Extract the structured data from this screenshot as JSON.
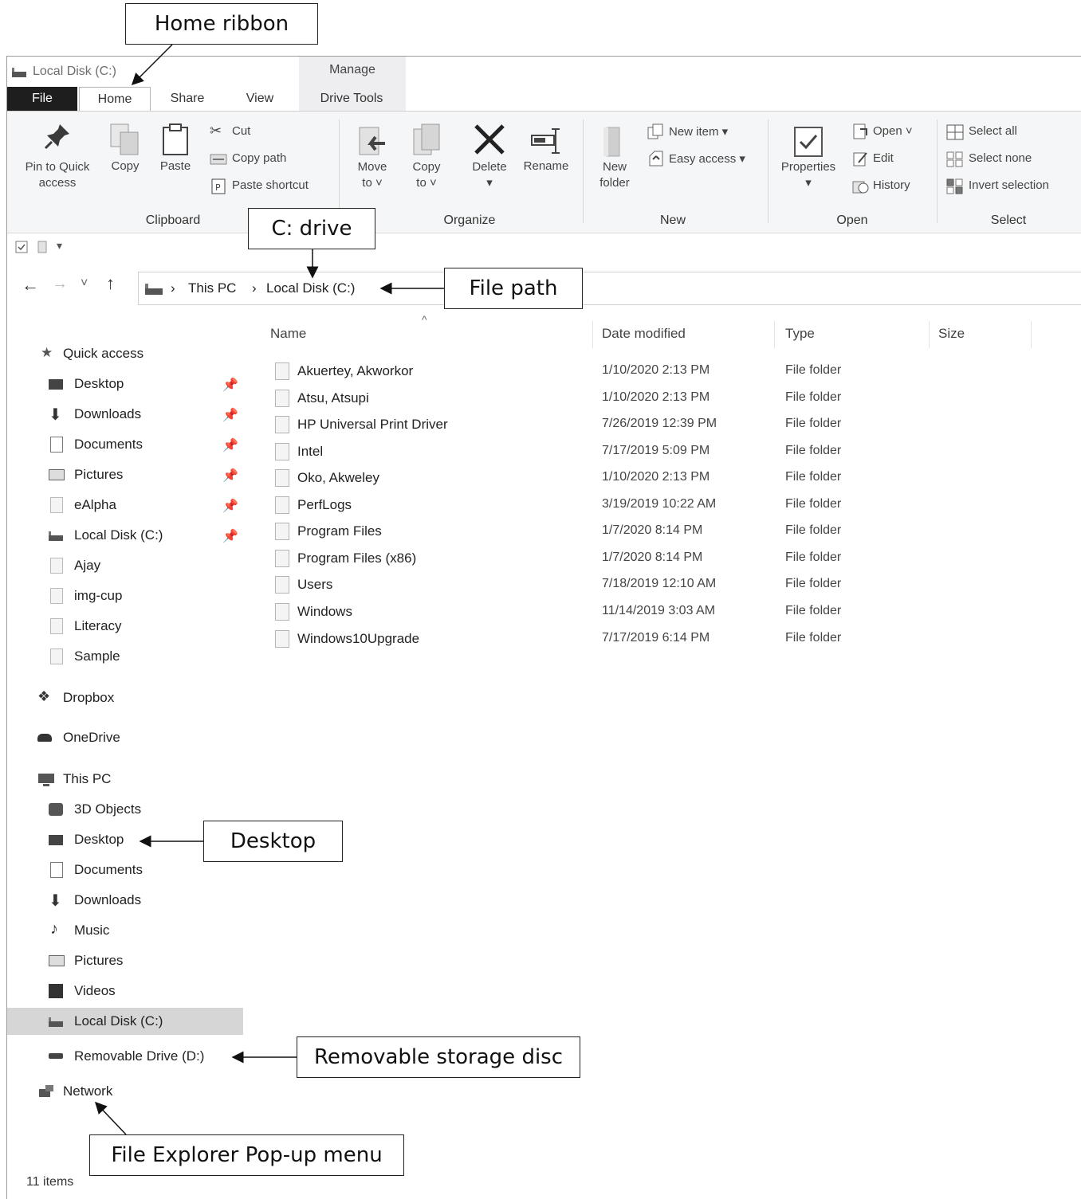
{
  "window": {
    "title": "Local Disk (C:)",
    "context_tab_group": "Manage",
    "tabs": [
      "File",
      "Home",
      "Share",
      "View",
      "Drive Tools"
    ]
  },
  "ribbon": {
    "clipboard": {
      "pin_label_line1": "Pin to Quick",
      "pin_label_line2": "access",
      "copy": "Copy",
      "paste": "Paste",
      "cut": "Cut",
      "copy_path": "Copy path",
      "paste_shortcut": "Paste shortcut",
      "group": "Clipboard"
    },
    "organize": {
      "move_line1": "Move",
      "move_line2": "to ˅",
      "copy_line1": "Copy",
      "copy_line2": "to ˅",
      "delete": "Delete",
      "rename": "Rename",
      "group": "Organize"
    },
    "new": {
      "new_folder_line1": "New",
      "new_folder_line2": "folder",
      "new_item": "New item ▾",
      "easy_access": "Easy access ▾",
      "group": "New"
    },
    "open": {
      "properties": "Properties",
      "open": "Open ˅",
      "edit": "Edit",
      "history": "History",
      "group": "Open"
    },
    "select": {
      "select_all": "Select all",
      "select_none": "Select none",
      "invert_selection": "Invert selection",
      "group": "Select"
    }
  },
  "qat": {
    "dropdown": "▾"
  },
  "navigation": {
    "back": "←",
    "forward": "→",
    "recent": "˅",
    "up": "↑",
    "breadcrumb": [
      "This PC",
      "Local Disk (C:)"
    ],
    "separator": "›"
  },
  "sidebar": {
    "quick_access": "Quick access",
    "quick_items": [
      "Desktop",
      "Downloads",
      "Documents",
      "Pictures",
      "eAlpha",
      "Local Disk (C:)",
      "Ajay",
      "img-cup",
      "Literacy",
      "Sample"
    ],
    "dropbox": "Dropbox",
    "onedrive": "OneDrive",
    "this_pc": "This PC",
    "pc_items": [
      "3D Objects",
      "Desktop",
      "Documents",
      "Downloads",
      "Music",
      "Pictures",
      "Videos",
      "Local Disk (C:)"
    ],
    "removable": "Removable Drive (D:)",
    "network": "Network"
  },
  "columns": [
    "Name",
    "Date modified",
    "Type",
    "Size"
  ],
  "files": [
    {
      "name": "Akuertey, Akworkor",
      "date": "1/10/2020 2:13 PM",
      "type": "File folder"
    },
    {
      "name": "Atsu, Atsupi",
      "date": "1/10/2020 2:13 PM",
      "type": "File folder"
    },
    {
      "name": "HP Universal Print Driver",
      "date": "7/26/2019 12:39 PM",
      "type": "File folder"
    },
    {
      "name": "Intel",
      "date": "7/17/2019 5:09 PM",
      "type": "File folder"
    },
    {
      "name": "Oko, Akweley",
      "date": "1/10/2020 2:13 PM",
      "type": "File folder"
    },
    {
      "name": "PerfLogs",
      "date": "3/19/2019 10:22 AM",
      "type": "File folder"
    },
    {
      "name": "Program Files",
      "date": "1/7/2020 8:14 PM",
      "type": "File folder"
    },
    {
      "name": "Program Files (x86)",
      "date": "1/7/2020 8:14 PM",
      "type": "File folder"
    },
    {
      "name": "Users",
      "date": "7/18/2019 12:10 AM",
      "type": "File folder"
    },
    {
      "name": "Windows",
      "date": "11/14/2019 3:03 AM",
      "type": "File folder"
    },
    {
      "name": "Windows10Upgrade",
      "date": "7/17/2019 6:14 PM",
      "type": "File folder"
    }
  ],
  "status": "11 items",
  "callouts": {
    "home_ribbon": "Home ribbon",
    "c_drive": "C: drive",
    "file_path": "File path",
    "desktop": "Desktop",
    "removable": "Removable storage disc",
    "popup": "File Explorer Pop-up menu"
  },
  "colors": {
    "file_tab": "#1e1e1e",
    "selected_nav": "#d6d6d6",
    "ribbon_bg": "#f5f6f7"
  }
}
